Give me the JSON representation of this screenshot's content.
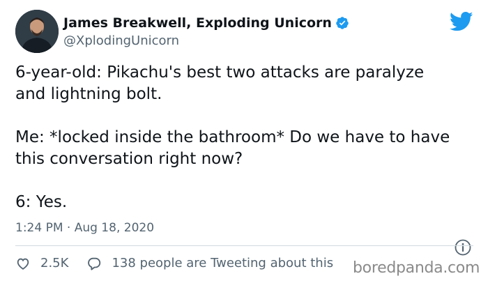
{
  "author": {
    "name": "James Breakwell, Exploding Unicorn",
    "handle": "@XplodingUnicorn"
  },
  "tweet": {
    "text": "6-year-old: Pikachu's best two attacks are paralyze\nand lightning bolt.\n\nMe: *locked inside the bathroom* Do we have to have\nthis conversation right now?\n\n6: Yes.",
    "timestamp": "1:24 PM · Aug 18, 2020"
  },
  "actions": {
    "likes": "2.5K",
    "replies_text": "138 people are Tweeting about this"
  },
  "watermark": "boredpanda.com",
  "colors": {
    "twitter_blue": "#1d9bf0",
    "secondary_text": "#536471",
    "divider": "#cfd9de"
  },
  "icons": [
    "avatar-photo",
    "verified-badge-icon",
    "twitter-bird-icon",
    "info-icon",
    "heart-icon",
    "reply-bubble-icon"
  ]
}
